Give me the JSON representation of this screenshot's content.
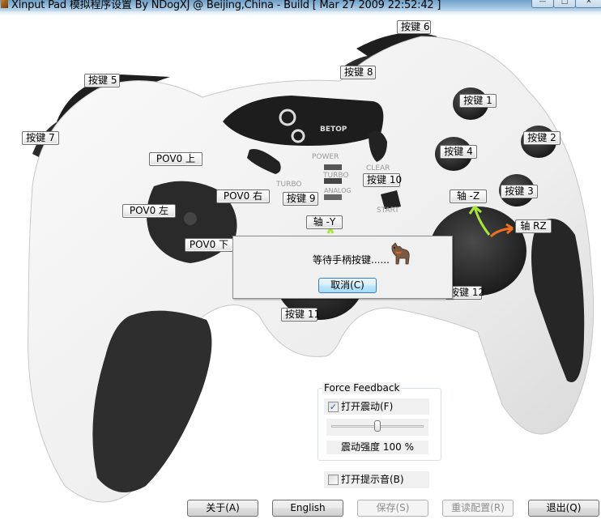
{
  "window": {
    "title": "Xinput Pad 模拟程序设置 By NDogXJ @ Beijing,China - Build [ Mar 27 2009 22:52:42 ]",
    "app_icon": "app-icon",
    "controls": {
      "minimize": "—",
      "maximize": "□",
      "close": "✕"
    }
  },
  "pad_labels": {
    "button5": "按键 5",
    "button6": "按键 6",
    "button7": "按键 7",
    "button8": "按键 8",
    "button1": "按键 1",
    "button2": "按键 2",
    "button3": "按键 3",
    "button4": "按键 4",
    "button9": "按键 9",
    "button10": "按键 10",
    "button11": "按键 11",
    "button12": "按键 12",
    "pov_up": "POV0 上",
    "pov_down": "POV0 下",
    "pov_left": "POV0 左",
    "pov_right": "POV0 右",
    "axis_y": "轴 -Y",
    "axis_z": "轴 -Z",
    "axis_rz": "轴 RZ"
  },
  "pad_text": {
    "brand": "BETOP",
    "power": "POWER",
    "turbo_left": "TURBO",
    "turbo_mid": "TURBO",
    "analog": "ANALOG",
    "clear": "CLEAR",
    "start": "START"
  },
  "arrow_colors": {
    "axis_z": "#a6e63a",
    "axis_rz": "#f07020"
  },
  "dialog": {
    "message": "等待手柄按键......",
    "cancel_label": "取消(C)",
    "icon": "dog-icon"
  },
  "force_feedback": {
    "group_label": "Force Feedback",
    "vibration_checkbox": {
      "label": "打开震动(F)",
      "checked": true
    },
    "strength_slider": {
      "value_percent": 100,
      "min": 0,
      "max": 200
    },
    "strength_label": "震动强度 100 %"
  },
  "sound_checkbox": {
    "label": "打开提示音(B)",
    "checked": false
  },
  "buttons": {
    "about": "关于(A)",
    "language": "English",
    "save": "保存(S)",
    "reload": "重读配置(R)",
    "exit": "退出(Q)"
  }
}
